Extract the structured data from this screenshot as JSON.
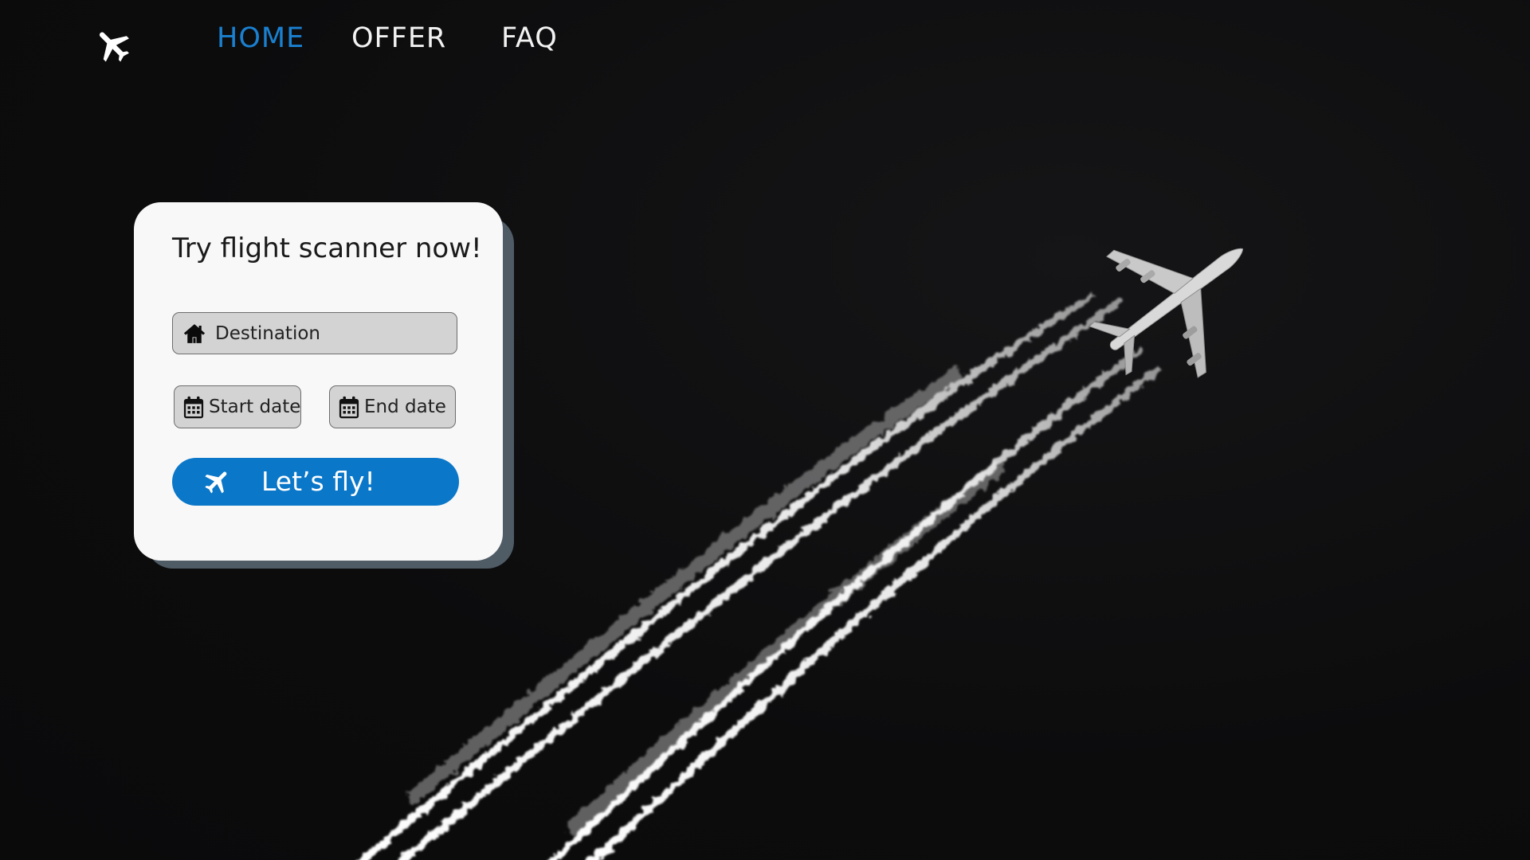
{
  "nav": {
    "logo_icon": "airplane-icon",
    "links": [
      {
        "label": "HOME",
        "active": true
      },
      {
        "label": "OFFER",
        "active": false
      },
      {
        "label": "FAQ",
        "active": false
      }
    ]
  },
  "card": {
    "title": "Try flight scanner now!",
    "destination": {
      "icon": "home-icon",
      "placeholder": "Destination"
    },
    "start_date": {
      "icon": "calendar-icon",
      "label": "Start date"
    },
    "end_date": {
      "icon": "calendar-icon",
      "label": "End date"
    },
    "submit": {
      "icon": "airplane-icon",
      "label": "Let’s fly!"
    }
  },
  "colors": {
    "accent": "#0b77c8",
    "nav_active": "#1a80d0",
    "background": "#0d0d0e",
    "card": "#f8f8f8",
    "card_shadow": "#4f5c66",
    "field": "#d3d3d3"
  },
  "hero_image": {
    "subject": "airplane-with-contrails"
  }
}
